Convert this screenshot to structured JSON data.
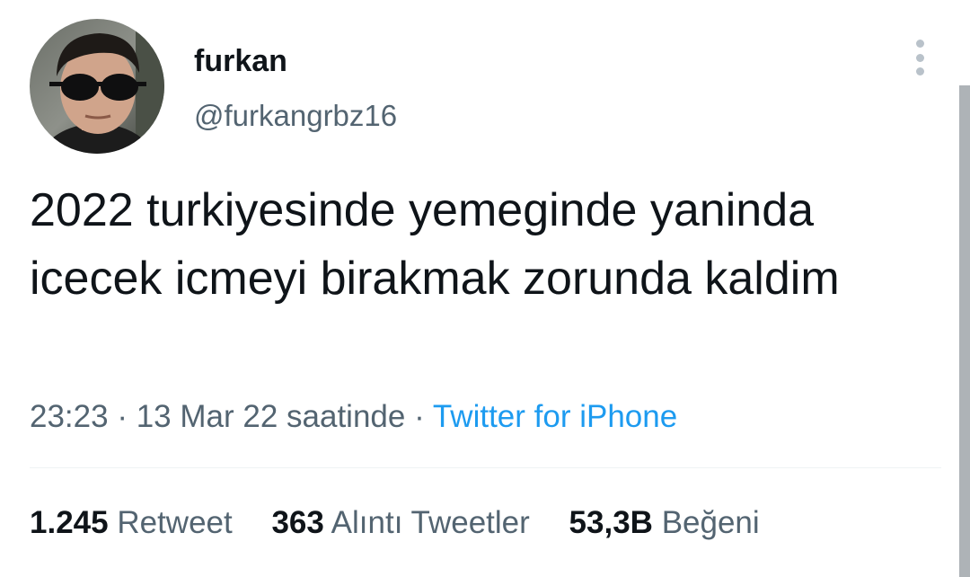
{
  "author": {
    "display_name": "furkan",
    "handle": "@furkangrbz16",
    "avatar_icon": "user-avatar-sunglasses"
  },
  "tweet": {
    "text": "2022 turkiyesinde yemeginde yaninda icecek icmeyi birakmak zorunda kaldim",
    "time": "23:23",
    "separator": "·",
    "date": "13 Mar 22 saatinde",
    "source": "Twitter for iPhone"
  },
  "stats": [
    {
      "count": "1.245",
      "label": "Retweet"
    },
    {
      "count": "363",
      "label": "Alıntı Tweetler"
    },
    {
      "count": "53,3B",
      "label": "Beğeni"
    }
  ],
  "colors": {
    "text_primary": "#0f1419",
    "text_secondary": "#536471",
    "link": "#1d9bf0",
    "background": "#ffffff"
  }
}
